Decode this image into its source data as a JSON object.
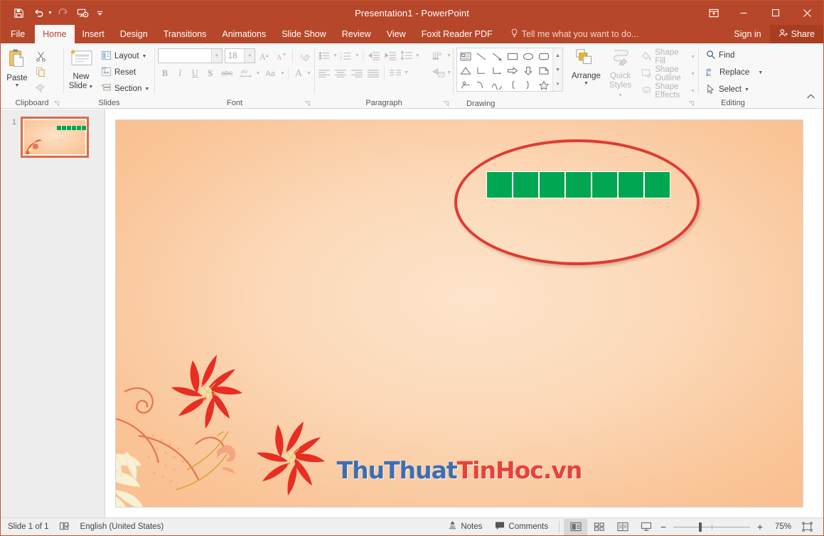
{
  "window": {
    "title": "Presentation1 - PowerPoint",
    "quick_access": [
      {
        "name": "save-icon",
        "label": "Save"
      },
      {
        "name": "undo-icon",
        "label": "Undo"
      },
      {
        "name": "redo-icon",
        "label": "Redo"
      },
      {
        "name": "start-slideshow-icon",
        "label": "Start From Beginning"
      },
      {
        "name": "customize-qat-icon",
        "label": "Customize Quick Access Toolbar"
      }
    ],
    "controls": {
      "ribbon_display": "Ribbon Display Options",
      "minimize": "Minimize",
      "maximize": "Restore Down",
      "close": "Close"
    },
    "accent_color": "#B7472A"
  },
  "tabs": [
    {
      "label": "File",
      "active": false
    },
    {
      "label": "Home",
      "active": true
    },
    {
      "label": "Insert",
      "active": false
    },
    {
      "label": "Design",
      "active": false
    },
    {
      "label": "Transitions",
      "active": false
    },
    {
      "label": "Animations",
      "active": false
    },
    {
      "label": "Slide Show",
      "active": false
    },
    {
      "label": "Review",
      "active": false
    },
    {
      "label": "View",
      "active": false
    },
    {
      "label": "Foxit Reader PDF",
      "active": false
    }
  ],
  "tellme": {
    "placeholder": "Tell me what you want to do..."
  },
  "account": {
    "signin": "Sign in",
    "share": "Share"
  },
  "ribbon": {
    "clipboard": {
      "group_label": "Clipboard",
      "paste_label": "Paste",
      "cut_label": "Cut",
      "copy_label": "Copy",
      "format_painter_label": "Format Painter"
    },
    "slides": {
      "group_label": "Slides",
      "new_slide_label": "New\nSlide",
      "new_slide_line1": "New",
      "new_slide_line2": "Slide",
      "layout_label": "Layout",
      "reset_label": "Reset",
      "section_label": "Section"
    },
    "font": {
      "group_label": "Font",
      "font_name_value": "",
      "font_size_value": "18",
      "grow_font_label": "Increase Font Size",
      "shrink_font_label": "Decrease Font Size",
      "clear_formatting_label": "Clear All Formatting",
      "bold_label": "B",
      "italic_label": "I",
      "underline_label": "U",
      "shadow_label": "S",
      "strikethrough_label": "abc",
      "char_spacing_label": "AV",
      "change_case_label": "Aa",
      "font_color_label": "A",
      "disabled": true
    },
    "paragraph": {
      "group_label": "Paragraph",
      "bullets_label": "Bullets",
      "numbering_label": "Numbering",
      "decrease_indent_label": "Decrease List Level",
      "increase_indent_label": "Increase List Level",
      "line_spacing_label": "Line Spacing",
      "text_direction_label": "Text Direction",
      "align_text_label": "Align Text",
      "convert_smartart_label": "Convert to SmartArt",
      "align_left_label": "Align Left",
      "center_label": "Center",
      "align_right_label": "Align Right",
      "justify_label": "Justify",
      "columns_label": "Columns",
      "disabled": true
    },
    "drawing": {
      "group_label": "Drawing",
      "arrange_label": "Arrange",
      "quick_styles_line1": "Quick",
      "quick_styles_line2": "Styles",
      "shape_fill_label": "Shape Fill",
      "shape_outline_label": "Shape Outline",
      "shape_effects_label": "Shape Effects",
      "shapes": [
        "text-box-shape",
        "line-shape",
        "arrow-shape",
        "rectangle-shape",
        "oval-shape",
        "rounded-rectangle-shape",
        "triangle-shape",
        "elbow-connector-shape",
        "elbow-arrow-connector-shape",
        "right-arrow-shape",
        "down-arrow-shape",
        "flowchart-shape",
        "scribble-shape",
        "arc-shape",
        "curve-shape",
        "left-brace-shape",
        "right-brace-shape",
        "star-shape"
      ]
    },
    "editing": {
      "group_label": "Editing",
      "find_label": "Find",
      "replace_label": "Replace",
      "select_label": "Select"
    },
    "collapse_label": "Collapse the Ribbon"
  },
  "thumbnails": [
    {
      "number": "1",
      "squares": 7
    }
  ],
  "slide": {
    "squares_count": 7,
    "square_color": "#00A651",
    "annotation_color": "#E03A32",
    "watermark": {
      "part1": "ThuThuat",
      "part2": "TinHoc.vn",
      "color1": "#3A6FB5",
      "color2": "#E8413C"
    }
  },
  "statusbar": {
    "slide_counter": "Slide 1 of 1",
    "spellcheck_label": "Spelling Check",
    "language": "English (United States)",
    "notes_label": "Notes",
    "comments_label": "Comments",
    "views": [
      {
        "name": "normal-view-button",
        "label": "Normal",
        "active": true
      },
      {
        "name": "slide-sorter-view-button",
        "label": "Slide Sorter",
        "active": false
      },
      {
        "name": "reading-view-button",
        "label": "Reading View",
        "active": false
      },
      {
        "name": "slideshow-view-button",
        "label": "Slide Show",
        "active": false
      }
    ],
    "zoom_out_label": "−",
    "zoom_in_label": "+",
    "zoom_level": "75%",
    "fit_label": "Fit slide to current window"
  }
}
